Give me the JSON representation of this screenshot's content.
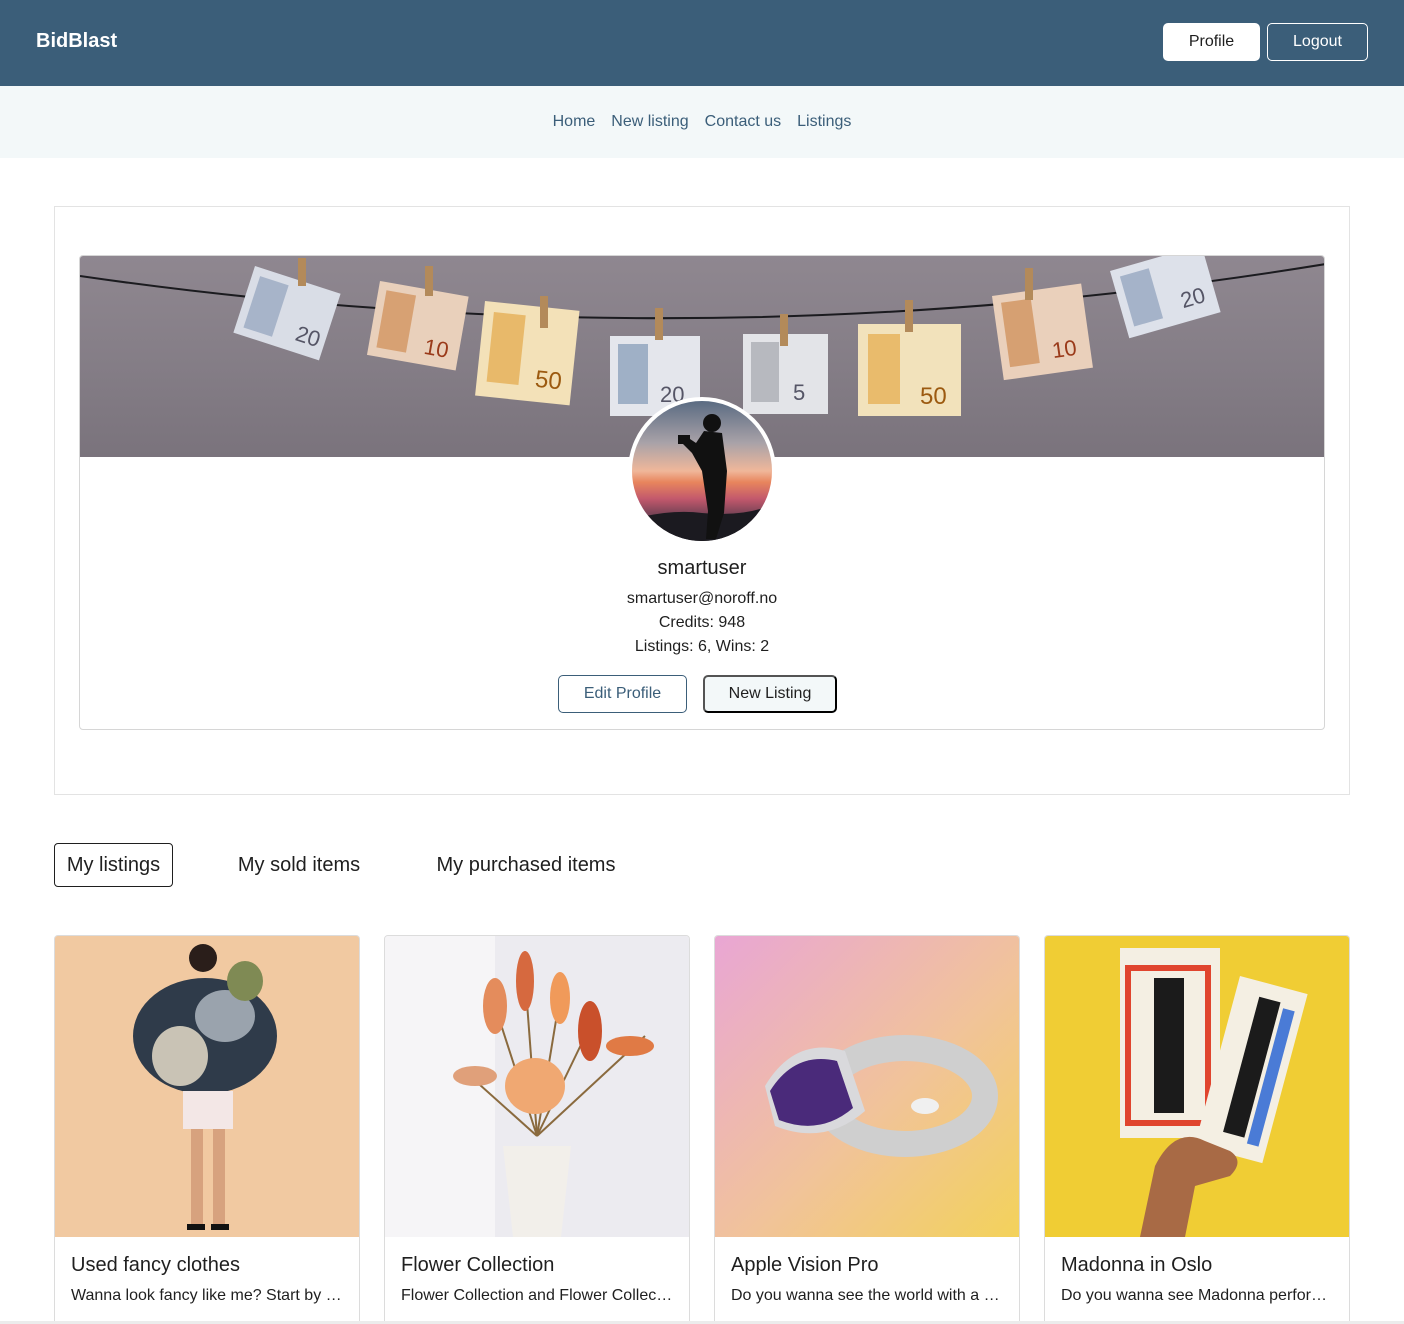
{
  "header": {
    "brand": "BidBlast",
    "profile_label": "Profile",
    "logout_label": "Logout",
    "bg_color": "#3b5e79"
  },
  "nav": {
    "items": [
      {
        "label": "Home"
      },
      {
        "label": "New listing"
      },
      {
        "label": "Contact us"
      },
      {
        "label": "Listings"
      }
    ]
  },
  "profile": {
    "username": "smartuser",
    "email": "smartuser@noroff.no",
    "credits": "Credits: 948",
    "stats": "Listings: 6, Wins: 2",
    "edit_label": "Edit Profile",
    "new_listing_label": "New Listing",
    "banner_icon": "banknotes-on-clothesline-image",
    "avatar_icon": "silhouette-photographer-sunset-image"
  },
  "tabs": [
    {
      "label": "My listings",
      "active": true
    },
    {
      "label": "My sold items",
      "active": false
    },
    {
      "label": "My purchased items",
      "active": false
    }
  ],
  "listings": [
    {
      "title": "Used fancy clothes",
      "description": "Wanna look fancy like me? Start by buying these clothes",
      "image": "woman-carrying-clothes-image"
    },
    {
      "title": "Flower Collection",
      "description": "Flower Collection and Flower Collection of dried flowers",
      "image": "dried-flowers-vase-image"
    },
    {
      "title": "Apple Vision Pro",
      "description": "Do you wanna see the world with a new perspective",
      "image": "vr-headset-image"
    },
    {
      "title": "Madonna in Oslo",
      "description": "Do you wanna see Madonna perform live in Oslo",
      "image": "tickets-in-hand-image"
    }
  ]
}
